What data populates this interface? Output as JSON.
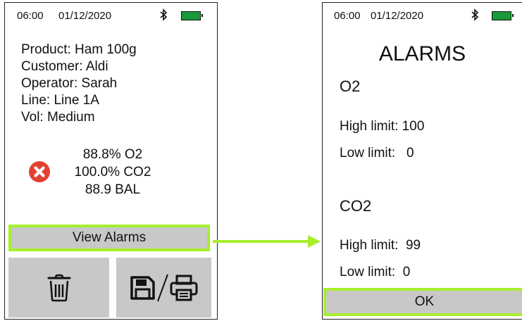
{
  "left_screen": {
    "status": {
      "time": "06:00",
      "date": "01/12/2020"
    },
    "info": {
      "product": "Product: Ham 100g",
      "customer": "Customer: Aldi",
      "operator": "Operator: Sarah",
      "line": "Line: Line 1A",
      "vol": "Vol: Medium"
    },
    "readings": {
      "o2": "88.8% O2",
      "co2": "100.0% CO2",
      "bal": "88.9 BAL"
    },
    "alarm_icon": "error-x-icon",
    "view_alarms_label": "View Alarms",
    "delete_icon": "trash-icon",
    "save_print_icon": "save-print-icon"
  },
  "right_screen": {
    "status": {
      "time": "06:00",
      "date": "01/12/2020"
    },
    "title": "ALARMS",
    "o2": {
      "label": "O2",
      "high": "High limit: 100",
      "low": "Low limit:   0"
    },
    "co2": {
      "label": "CO2",
      "high": "High limit:  99",
      "low": "Low limit:  0"
    },
    "ok_label": "OK"
  },
  "colors": {
    "highlight": "#a6ef2b",
    "battery": "#189a3a",
    "alarm": "#e24132",
    "button": "#c8c8c8"
  }
}
